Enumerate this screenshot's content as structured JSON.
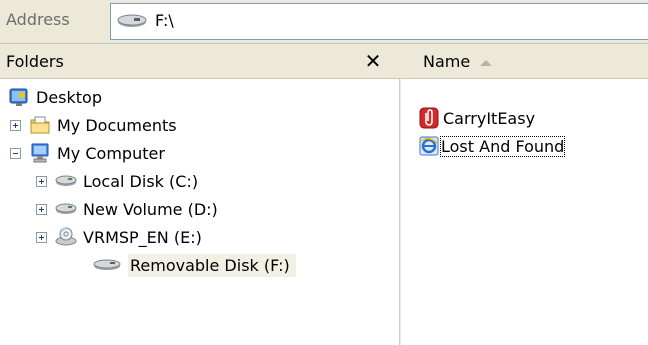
{
  "address": {
    "label": "Address",
    "value": "F:\\"
  },
  "folders": {
    "title": "Folders",
    "close_symbol": "✕",
    "tree": [
      {
        "label": "Desktop",
        "icon": "desktop-icon"
      },
      {
        "label": "My Documents",
        "icon": "folder-documents-icon",
        "expander": "plus"
      },
      {
        "label": "My Computer",
        "icon": "computer-icon",
        "expander": "minus"
      },
      {
        "label": "Local Disk (C:)",
        "icon": "hard-drive-icon",
        "expander": "plus"
      },
      {
        "label": "New Volume (D:)",
        "icon": "hard-drive-icon",
        "expander": "plus"
      },
      {
        "label": "VRMSP_EN (E:)",
        "icon": "cd-drive-icon",
        "expander": "plus"
      },
      {
        "label": "Removable Disk (F:)",
        "icon": "removable-drive-icon",
        "selected": true
      }
    ]
  },
  "files": {
    "column_name": "Name",
    "items": [
      {
        "label": "CarryItEasy",
        "icon": "carryiteasy-icon"
      },
      {
        "label": "Lost And Found",
        "icon": "internet-explorer-icon",
        "focused": true
      }
    ]
  },
  "colors": {
    "chrome": "#ece9d8",
    "border": "#7f9db9",
    "selection": "#f2f0e4"
  }
}
